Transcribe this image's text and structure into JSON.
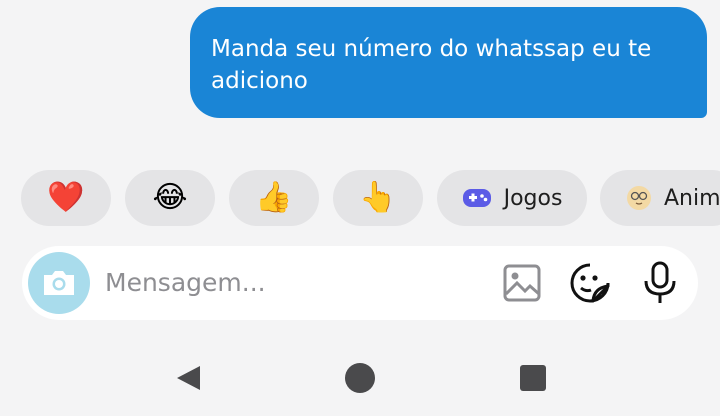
{
  "message": {
    "text": "Manda seu número do whatssap eu te adiciono"
  },
  "quick_replies": [
    {
      "emoji": "❤️",
      "icon": "heart-emoji"
    },
    {
      "emoji": "😂",
      "icon": "tears-of-joy-emoji"
    },
    {
      "emoji": "👍",
      "icon": "thumbs-up-emoji"
    },
    {
      "emoji": "👆",
      "icon": "pointing-up-emoji"
    },
    {
      "label": "Jogos",
      "icon": "gamepad-icon"
    },
    {
      "label": "Anim",
      "icon": "animated-face-icon"
    }
  ],
  "composer": {
    "placeholder": "Mensagem...",
    "icons": [
      "camera-icon",
      "gallery-icon",
      "sticker-icon",
      "microphone-icon"
    ]
  },
  "nav": {
    "icons": [
      "back-icon",
      "home-icon",
      "recents-icon"
    ]
  },
  "colors": {
    "bubble": "#1a85d6",
    "camera_button": "#a9dcec",
    "chip": "#e4e4e6",
    "gamepad": "#5b5be6"
  }
}
